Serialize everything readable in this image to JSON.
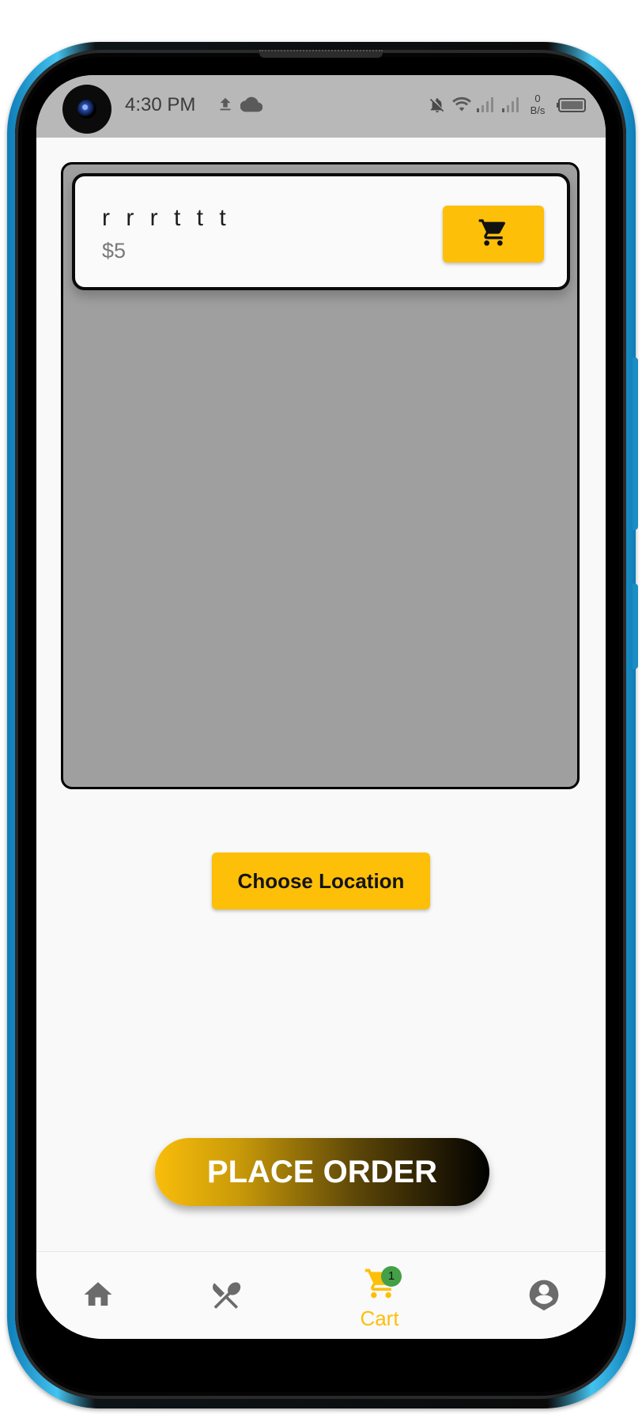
{
  "status_bar": {
    "time": "4:30 PM",
    "net_speed_value": "0",
    "net_speed_unit": "B/s",
    "icons": [
      "upload-icon",
      "cloud-icon",
      "bell-off-icon",
      "wifi-icon",
      "signal-icon",
      "signal-icon",
      "battery-icon"
    ]
  },
  "cart": {
    "items": [
      {
        "name": "r r r t t t",
        "price": "$5",
        "action_icon": "shopping-cart-icon"
      }
    ]
  },
  "choose_location_label": "Choose Location",
  "place_order_label": "PLACE ORDER",
  "bottom_nav": {
    "items": [
      {
        "id": "home",
        "icon": "home-icon",
        "label": ""
      },
      {
        "id": "menu",
        "icon": "fork-spoon-icon",
        "label": ""
      },
      {
        "id": "cart",
        "icon": "shopping-cart-icon",
        "label": "Cart",
        "badge": "1",
        "active": true
      },
      {
        "id": "profile",
        "icon": "account-icon",
        "label": ""
      }
    ]
  },
  "colors": {
    "accent": "#fdbf08",
    "badge": "#43a047",
    "panel_bg": "#9f9f9f",
    "status_bar_bg": "#b8b8b8"
  }
}
